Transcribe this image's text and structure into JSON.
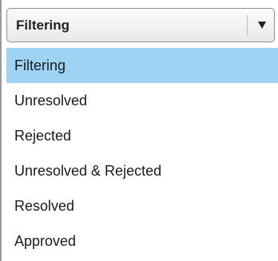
{
  "select": {
    "selected_label": "Filtering",
    "arrow_icon": "triangle-down-icon"
  },
  "menu": {
    "items": [
      {
        "label": "Filtering",
        "selected": true
      },
      {
        "label": "Unresolved",
        "selected": false
      },
      {
        "label": "Rejected",
        "selected": false
      },
      {
        "label": "Unresolved & Rejected",
        "selected": false
      },
      {
        "label": "Resolved",
        "selected": false
      },
      {
        "label": "Approved",
        "selected": false
      }
    ]
  },
  "colors": {
    "highlight": "#9fd3f3",
    "text": "#1a1a1a"
  }
}
